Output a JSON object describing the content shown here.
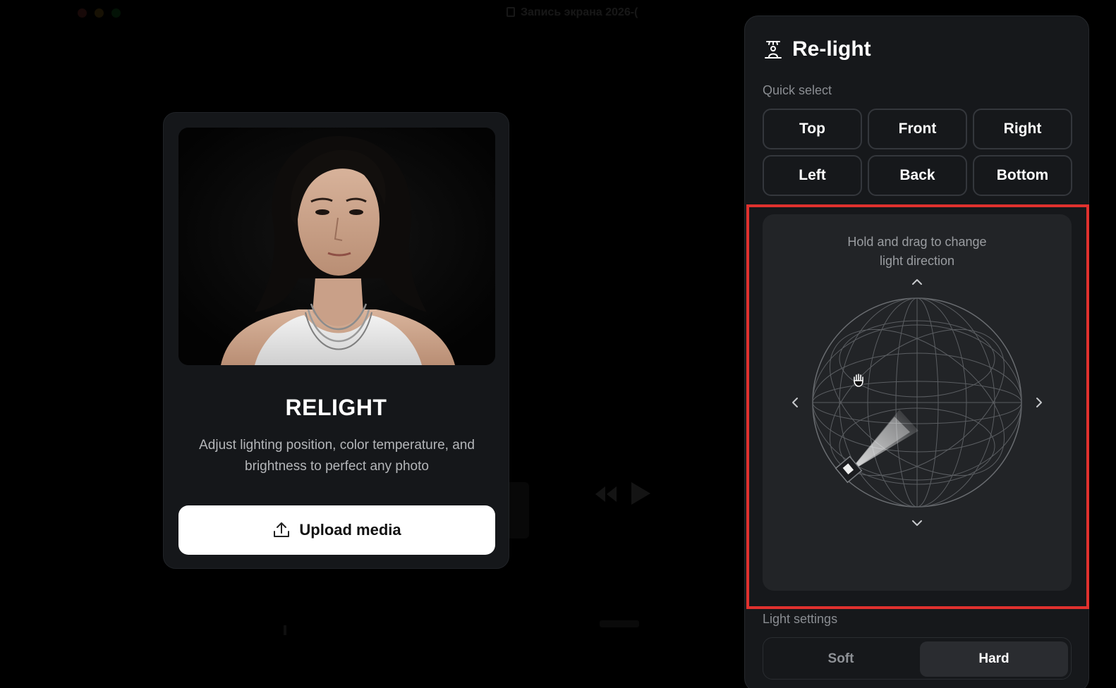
{
  "background": {
    "window_title": "Запись экрана 2026-("
  },
  "card": {
    "title": "RELIGHT",
    "description": "Adjust lighting position, color temperature, and brightness to perfect any photo",
    "upload_label": "Upload media",
    "upload_icon": "upload-icon",
    "photo": "portrait-photo"
  },
  "panel": {
    "title": "Re-light",
    "title_icon": "relight-icon",
    "quick_select_label": "Quick select",
    "quick_select": [
      {
        "label": "Top"
      },
      {
        "label": "Front"
      },
      {
        "label": "Right"
      },
      {
        "label": "Left"
      },
      {
        "label": "Back"
      },
      {
        "label": "Bottom"
      }
    ],
    "direction": {
      "hint_line1": "Hold and drag to change",
      "hint_line2": "light direction",
      "cursor_icon": "grab-hand-icon"
    },
    "light_settings_label": "Light settings",
    "light_modes": {
      "soft": "Soft",
      "hard": "Hard",
      "selected": "Hard"
    }
  },
  "colors": {
    "highlight": "#e0312e",
    "panel_bg": "#16181b",
    "card_bg": "#15171a"
  }
}
